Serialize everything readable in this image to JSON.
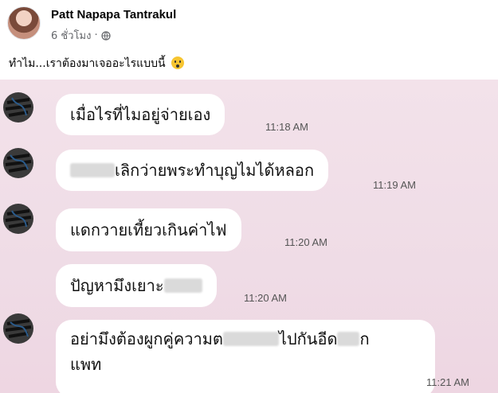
{
  "post": {
    "author": "Patt Napapa Tantrakul",
    "time": "6 ชั่วโมง",
    "caption": "ทำไม...เราต้องมาเจออะไรแบบนี้",
    "caption_emoji": "scream-emoji-icon"
  },
  "chat": {
    "messages": [
      {
        "text": "เมื่อไรที่ไมอยู่จ่ายเอง",
        "time": "11:18 AM"
      },
      {
        "text_after": "เลิกว่ายพระทำบุญไมได้หลอก",
        "time": "11:19 AM"
      },
      {
        "text": "แดกวายเที้ยวเกินค่าไฟ",
        "time": "11:20 AM"
      },
      {
        "text_before": "ปัญหามึงเยาะ",
        "time": "11:20 AM"
      },
      {
        "line1_a": "อย่ามึงต้องผูกคู่ความต",
        "line1_b": "ไปกันอีด",
        "line1_c": "ก",
        "line2": "แพท",
        "time": "11:21 AM"
      }
    ]
  },
  "colors": {
    "chat_background": "#efdce6",
    "bubble": "#ffffff"
  }
}
